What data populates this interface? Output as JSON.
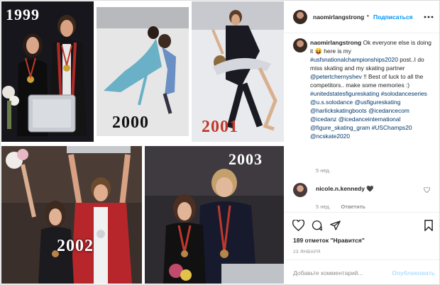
{
  "header": {
    "username": "naomirlangstrong",
    "separator": "•",
    "follow_label": "Подписаться",
    "more_icon": "more-horizontal-icon"
  },
  "collage": {
    "years": [
      "1999",
      "2000",
      "2001",
      "2002",
      "2003"
    ],
    "year_colors": {
      "1999": "#ffffff",
      "2000": "#111111",
      "2001": "#c0392b",
      "2002": "#ffffff",
      "2003": "#ffffff"
    }
  },
  "caption": {
    "username": "naomirlangstrong",
    "text": "Ok everyone else is doing it 😝 here is my",
    "tag1": "#usfsnationalchampionships2020",
    "text2": "post..I do miss skating and my skating partner",
    "mention1": "@petertchernyshev",
    "text3": "!! Best of luck to all the competitors.. make some memories :)",
    "tags": [
      "#unitedstatesfigureskating",
      "#solodanceseries",
      "@u.s.solodance",
      "@usfigureskating",
      "@harlickskatingboots",
      "@icedancecom",
      "@icedanz",
      "@icedanceinternational",
      "@figure_skating_gram",
      "#USChamps20",
      "@ncskate2020"
    ],
    "time": "5 нед."
  },
  "comment": {
    "username": "nicole.n.kennedy",
    "text": "🖤",
    "time": "5 нед.",
    "reply": "Ответить"
  },
  "actions": {
    "likes": "189 отметок \"Нравится\"",
    "date": "23 ЯНВАРЯ",
    "comment_placeholder": "Добавьте комментарий...",
    "publish_label": "Опубликовать"
  },
  "colors": {
    "accent": "#0095f6",
    "link": "#00376b",
    "muted": "#8e8e8e",
    "border": "#dbdbdb"
  }
}
